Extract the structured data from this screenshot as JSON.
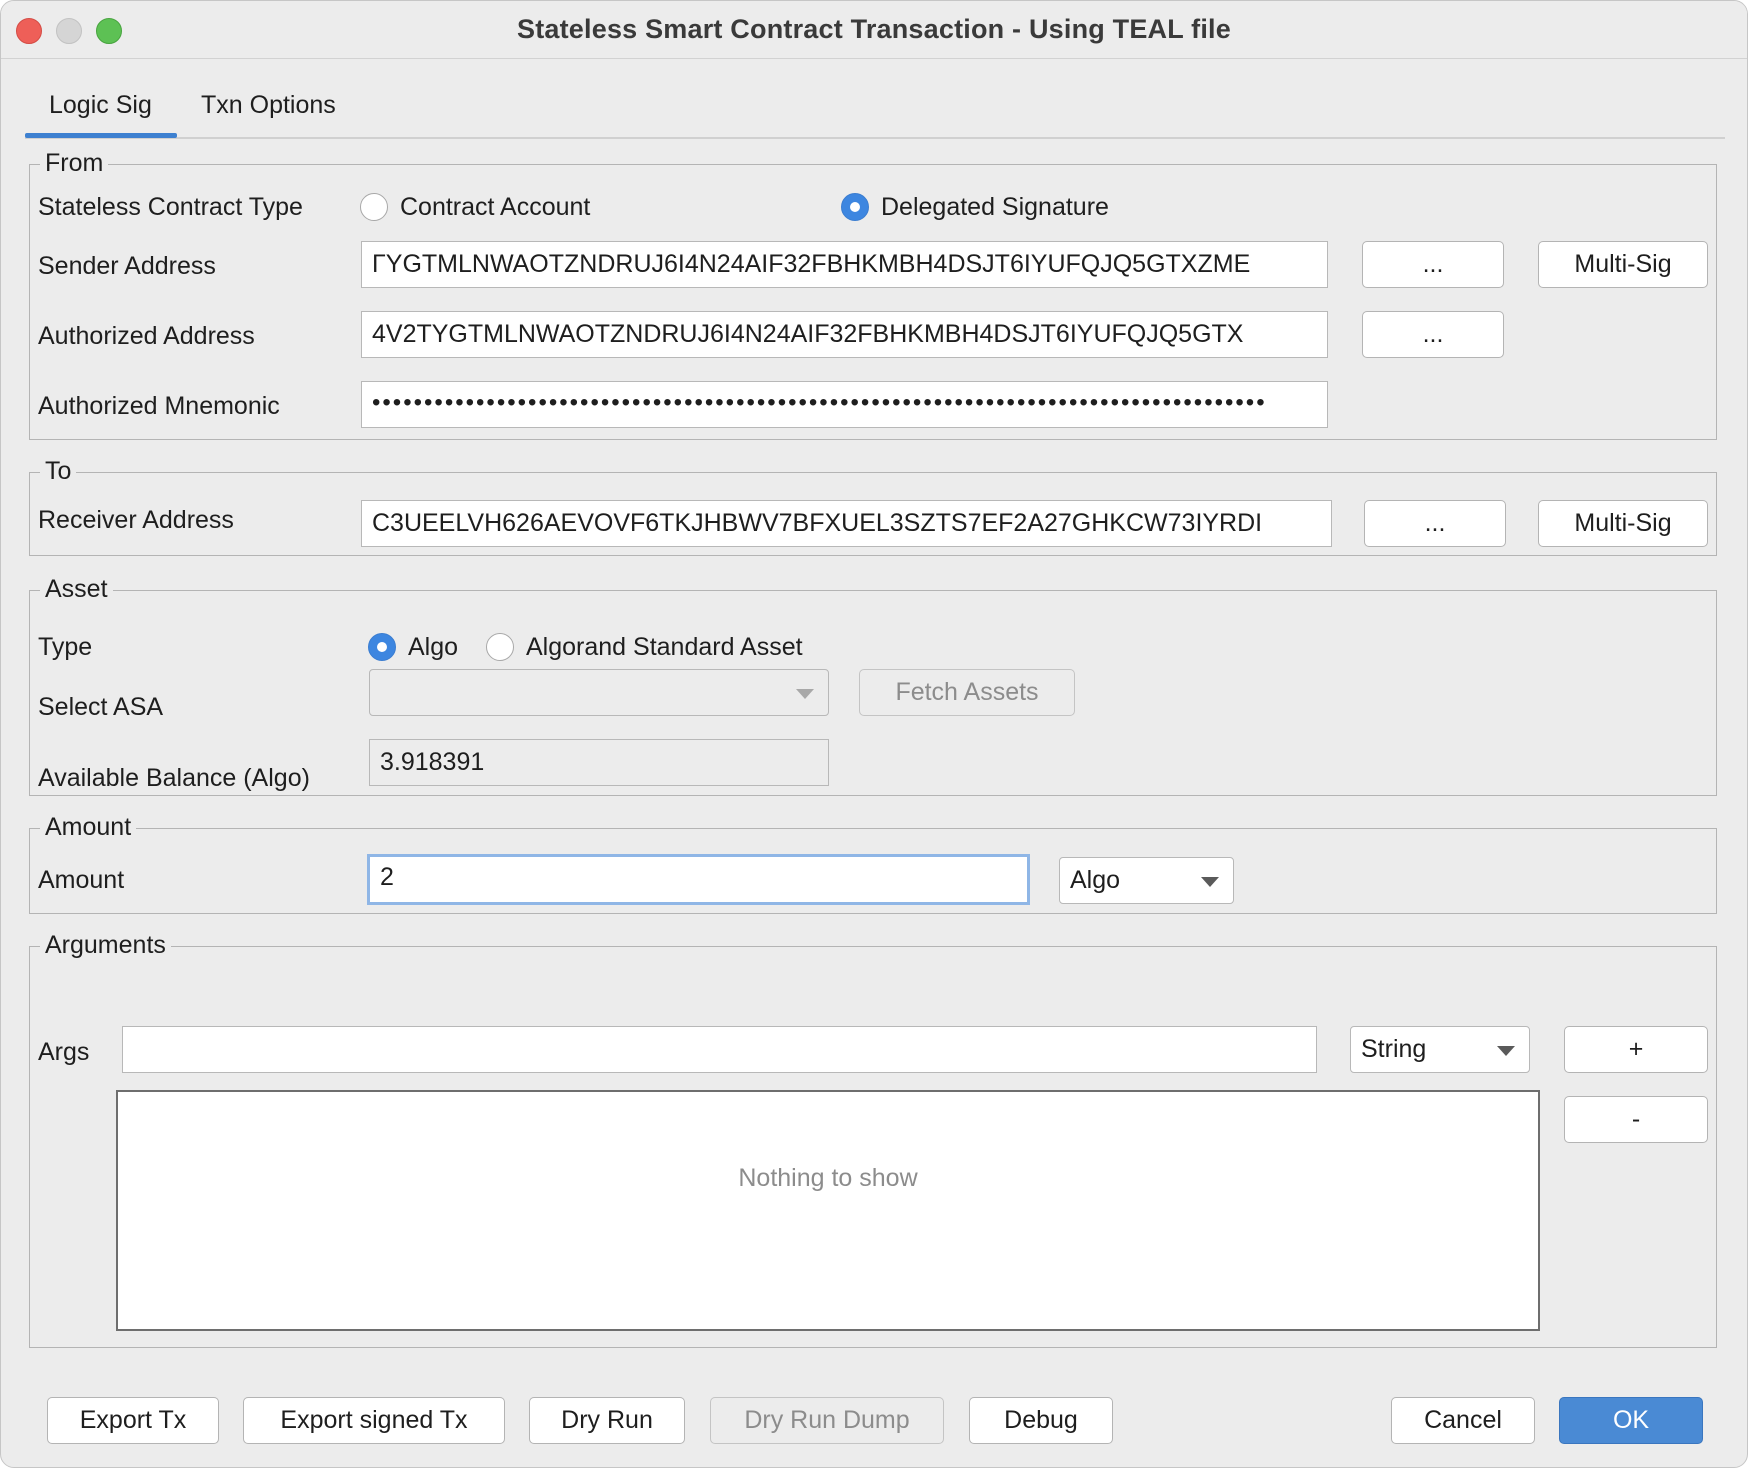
{
  "window": {
    "title": "Stateless Smart Contract Transaction - Using TEAL file"
  },
  "tabs": [
    {
      "label": "Logic Sig",
      "active": true
    },
    {
      "label": "Txn Options",
      "active": false
    }
  ],
  "from": {
    "legend": "From",
    "contract_type_label": "Stateless Contract Type",
    "contract_type_options": [
      {
        "label": "Contract Account",
        "selected": false
      },
      {
        "label": "Delegated Signature",
        "selected": true
      }
    ],
    "sender_label": "Sender Address",
    "sender_value": "ΓYGTMLNWAOTZNDRUJ6I4N24AIF32FBHKMBH4DSJT6IYUFQJQ5GTXZME",
    "sender_browse": "...",
    "sender_multisig": "Multi-Sig",
    "authorized_label": "Authorized Address",
    "authorized_value": "4V2TYGTMLNWAOTZNDRUJ6I4N24AIF32FBHKMBH4DSJT6IYUFQJQ5GTX",
    "authorized_browse": "...",
    "mnemonic_label": "Authorized Mnemonic",
    "mnemonic_value": "••••••••••••••••••••••••••••••••••••••••••••••••••••••••••••••••••••••••••••••••••••••"
  },
  "to": {
    "legend": "To",
    "receiver_label": "Receiver Address",
    "receiver_value": "C3UEELVH626AEVOVF6TKJHBWV7BFXUEL3SZTS7EF2A27GHKCW73IYRDI",
    "receiver_browse": "...",
    "receiver_multisig": "Multi-Sig"
  },
  "asset": {
    "legend": "Asset",
    "type_label": "Type",
    "type_options": [
      {
        "label": "Algo",
        "selected": true
      },
      {
        "label": "Algorand Standard Asset",
        "selected": false
      }
    ],
    "select_asa_label": "Select ASA",
    "select_asa_value": "",
    "fetch_button": "Fetch Assets",
    "balance_label": "Available Balance (Algo)",
    "balance_value": "3.918391"
  },
  "amount": {
    "legend": "Amount",
    "amount_label": "Amount",
    "amount_value": "2",
    "unit_value": "Algo"
  },
  "arguments": {
    "legend": "Arguments",
    "args_label": "Args",
    "args_value": "",
    "args_type": "String",
    "add_button": "+",
    "remove_button": "-",
    "empty_text": "Nothing to show"
  },
  "footer": {
    "export_tx": "Export Tx",
    "export_signed_tx": "Export signed Tx",
    "dry_run": "Dry Run",
    "dry_run_dump": "Dry Run Dump",
    "debug": "Debug",
    "cancel": "Cancel",
    "ok": "OK"
  },
  "colors": {
    "accent": "#3d80d0",
    "primary_button": "#4a8ad4",
    "window_bg": "#ececec",
    "close": "#ee5f58",
    "minimize": "#d5d5d5",
    "maximize": "#5dc154"
  }
}
